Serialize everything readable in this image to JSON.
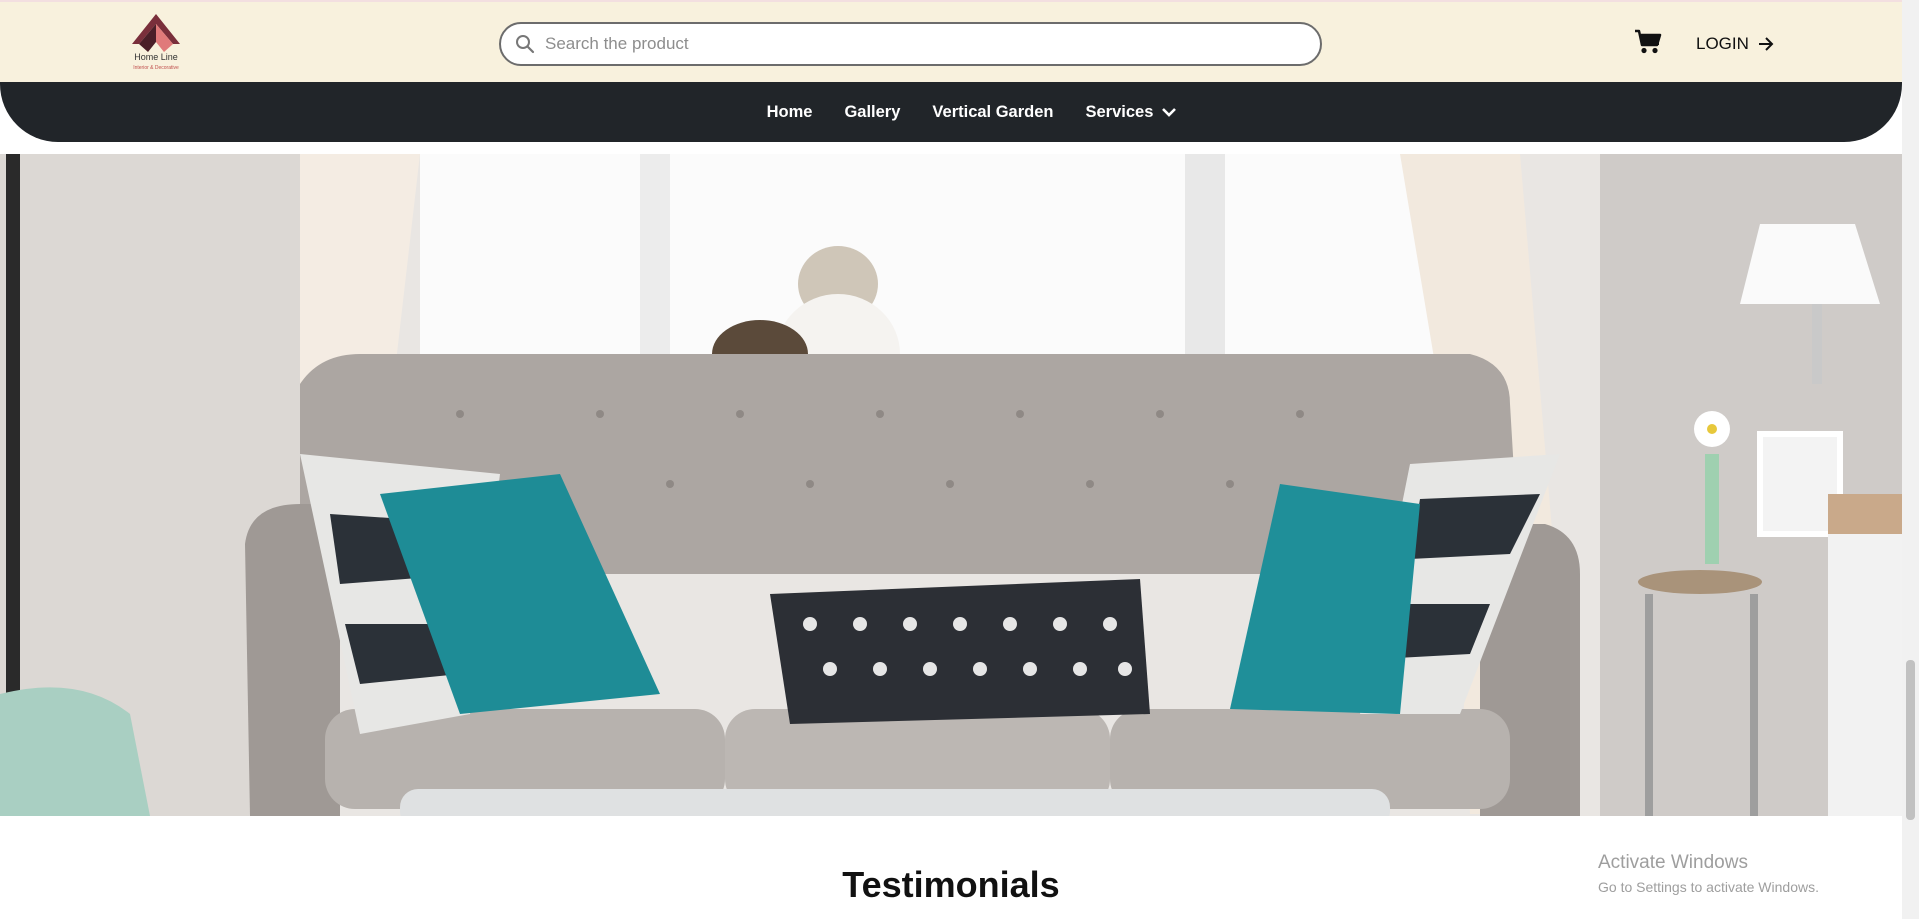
{
  "header": {
    "logo_text": "Home Line",
    "logo_subtext": "Interior & Decorative",
    "search_placeholder": "Search the product",
    "login_label": "LOGIN"
  },
  "nav": {
    "items": [
      {
        "label": "Home"
      },
      {
        "label": "Gallery"
      },
      {
        "label": "Vertical Garden"
      },
      {
        "label": "Services"
      }
    ]
  },
  "sections": {
    "testimonials_title": "Testimonials"
  },
  "watermark": {
    "title": "Activate Windows",
    "subtitle": "Go to Settings to activate Windows."
  },
  "colors": {
    "header_bg": "#f8f1dd",
    "nav_bg": "#212529",
    "pillow_teal": "#1e8c96"
  }
}
